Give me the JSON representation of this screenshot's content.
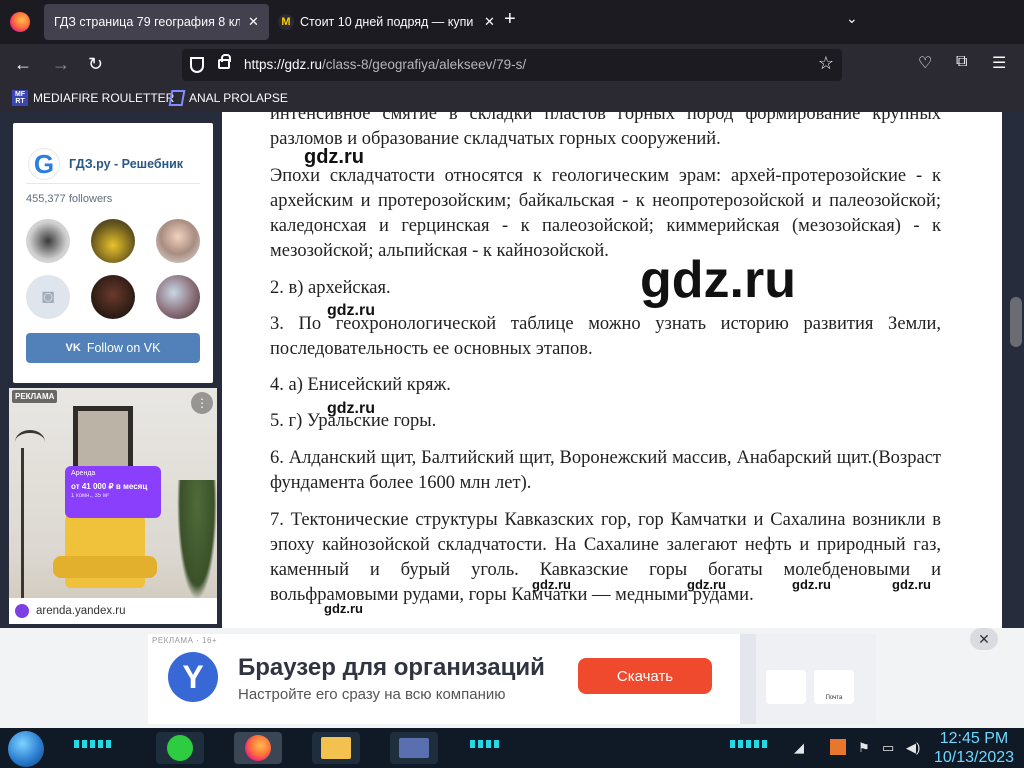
{
  "browser": {
    "tabs": [
      {
        "label": "ГДЗ страница 79 география 8 клас",
        "active": true
      },
      {
        "label": "Стоит 10 дней подряд — купи",
        "active": false
      }
    ],
    "url": {
      "host": "https://gdz.ru",
      "path": "/class-8/geografiya/alekseev/79-s/"
    },
    "bookmarks": [
      {
        "label": "MEDIAFIRE ROULETTER",
        "icon_text": "MF RT"
      },
      {
        "label": "ANAL PROLAPSE"
      }
    ]
  },
  "sidebar": {
    "vk_widget": {
      "name": "ГДЗ.ру - Решебник",
      "logo_letter": "G",
      "followers": "455,377 followers",
      "button_label": "Follow on VK",
      "vk_mark": "VK"
    },
    "ad": {
      "tag": "РЕКЛАМА",
      "badge": "Аренда",
      "price": "от 41 000 ₽ в месяц",
      "details": "1 комн., 35 м²",
      "domain": "arenda.yandex.ru"
    }
  },
  "content": {
    "paragraphs": [
      "интенсивное смятие в складки пластов горных пород формирование крупных разломов и образование складчатых горных сооружений.",
      "Эпохи складчатости относятся к геологическим эрам: архей-протерозойские - к архейским и протерозойским; байкальская - к неопротерозойской и палеозойской; каледонсхая и герцинская - к палеозойской; киммерийская (мезозойская) - к мезозойской; альпийская - к кайнозойской.",
      "2. в) архейская.",
      "3. По геохронологической таблице можно узнать историю развития Земли, последовательность ее основных этапов.",
      "4. а) Енисейский кряж.",
      "5. г) Уральские горы.",
      "6. Алданский щит, Балтийский щит, Воронежский массив, Анабарский щит.(Возраст фундамента более 1600 млн лет).",
      "7. Тектонические структуры Кавказских гор, гор Камчатки и Сахалина возникли в эпоху кайнозойской складчатости. На Сахалине залегают нефть и природный газ, каменный и бурый уголь. Кавказские горы богаты молебденовыми и вольфрамовыми рудами, горы Камчатки — медными рудами."
    ],
    "watermark": "gdz.ru"
  },
  "bottom_ad": {
    "tag": "РЕКЛАМА · 16+",
    "title": "Браузер для организаций",
    "subtitle": "Настройте его сразу на всю компанию",
    "button": "Скачать",
    "close": "✕",
    "tile_label": "Почта"
  },
  "taskbar": {
    "time": "12:45 PM",
    "date": "10/13/2023"
  },
  "colors": {
    "vk_button": "#5181b8",
    "ad_button": "#f04a2e",
    "clock": "#6fd7ff"
  }
}
